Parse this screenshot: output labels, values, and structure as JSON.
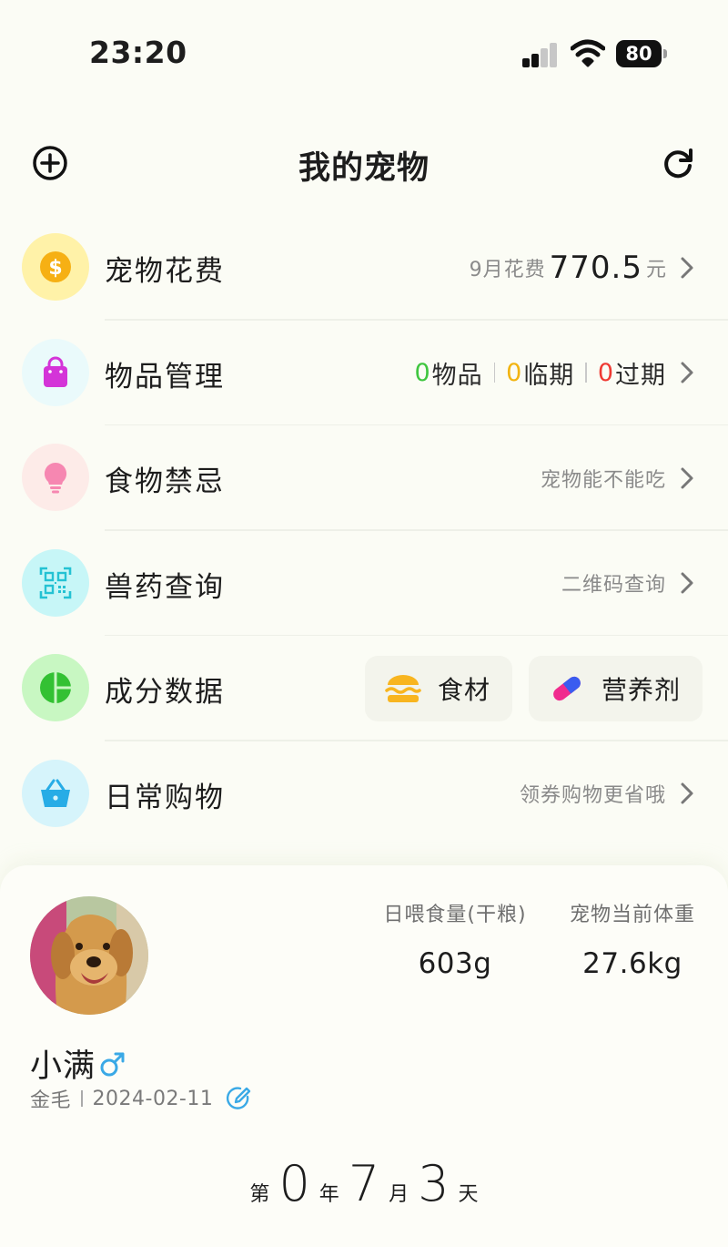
{
  "status_bar": {
    "time": "23:20",
    "battery": "80",
    "signal_level": 2
  },
  "header": {
    "title": "我的宠物",
    "add_icon": "plus-circle-icon",
    "refresh_icon": "refresh-icon"
  },
  "menu": {
    "spending": {
      "label": "宠物花费",
      "icon": "dollar-coin-icon",
      "month_label": "9月花费",
      "amount": "770.5",
      "unit": "元"
    },
    "items": {
      "label": "物品管理",
      "icon": "shopping-bag-icon",
      "stats": [
        {
          "count": "0",
          "label": "物品",
          "color": "#3fc63f"
        },
        {
          "count": "0",
          "label": "临期",
          "color": "#f2b411"
        },
        {
          "count": "0",
          "label": "过期",
          "color": "#ef3a33"
        }
      ]
    },
    "food_taboo": {
      "label": "食物禁忌",
      "icon": "lightbulb-icon",
      "hint": "宠物能不能吃"
    },
    "vet_drug": {
      "label": "兽药查询",
      "icon": "qr-scan-icon",
      "hint": "二维码查询"
    },
    "ingredients": {
      "label": "成分数据",
      "icon": "pie-chart-icon",
      "ingredient_btn": "食材",
      "supplement_btn": "营养剂"
    },
    "shopping": {
      "label": "日常购物",
      "icon": "basket-icon",
      "hint": "领券购物更省哦"
    }
  },
  "pet": {
    "name": "小满",
    "gender_symbol": "♂",
    "breed": "金毛",
    "birthday": "2024-02-11",
    "daily_food_label": "日喂食量(干粮)",
    "daily_food_value": "603g",
    "weight_label": "宠物当前体重",
    "weight_value": "27.6kg",
    "age": {
      "prefix": "第",
      "years": "0",
      "year_unit": "年",
      "months": "7",
      "month_unit": "月",
      "days": "3",
      "day_unit": "天"
    }
  },
  "colors": {
    "accent_blue": "#3aa9e6",
    "coin_bg": "#fff2a8",
    "coin": "#f6b014",
    "bag_bg": "#eafafb",
    "bag": "#d434d8",
    "bulb_bg": "#fdebe8",
    "bulb": "#f687b1",
    "qr_bg": "#c7f6f7",
    "qr": "#24c2d3",
    "pie_bg": "#c8f7c2",
    "pie": "#33c133",
    "basket_bg": "#d6f4fb",
    "basket": "#27ace6"
  }
}
